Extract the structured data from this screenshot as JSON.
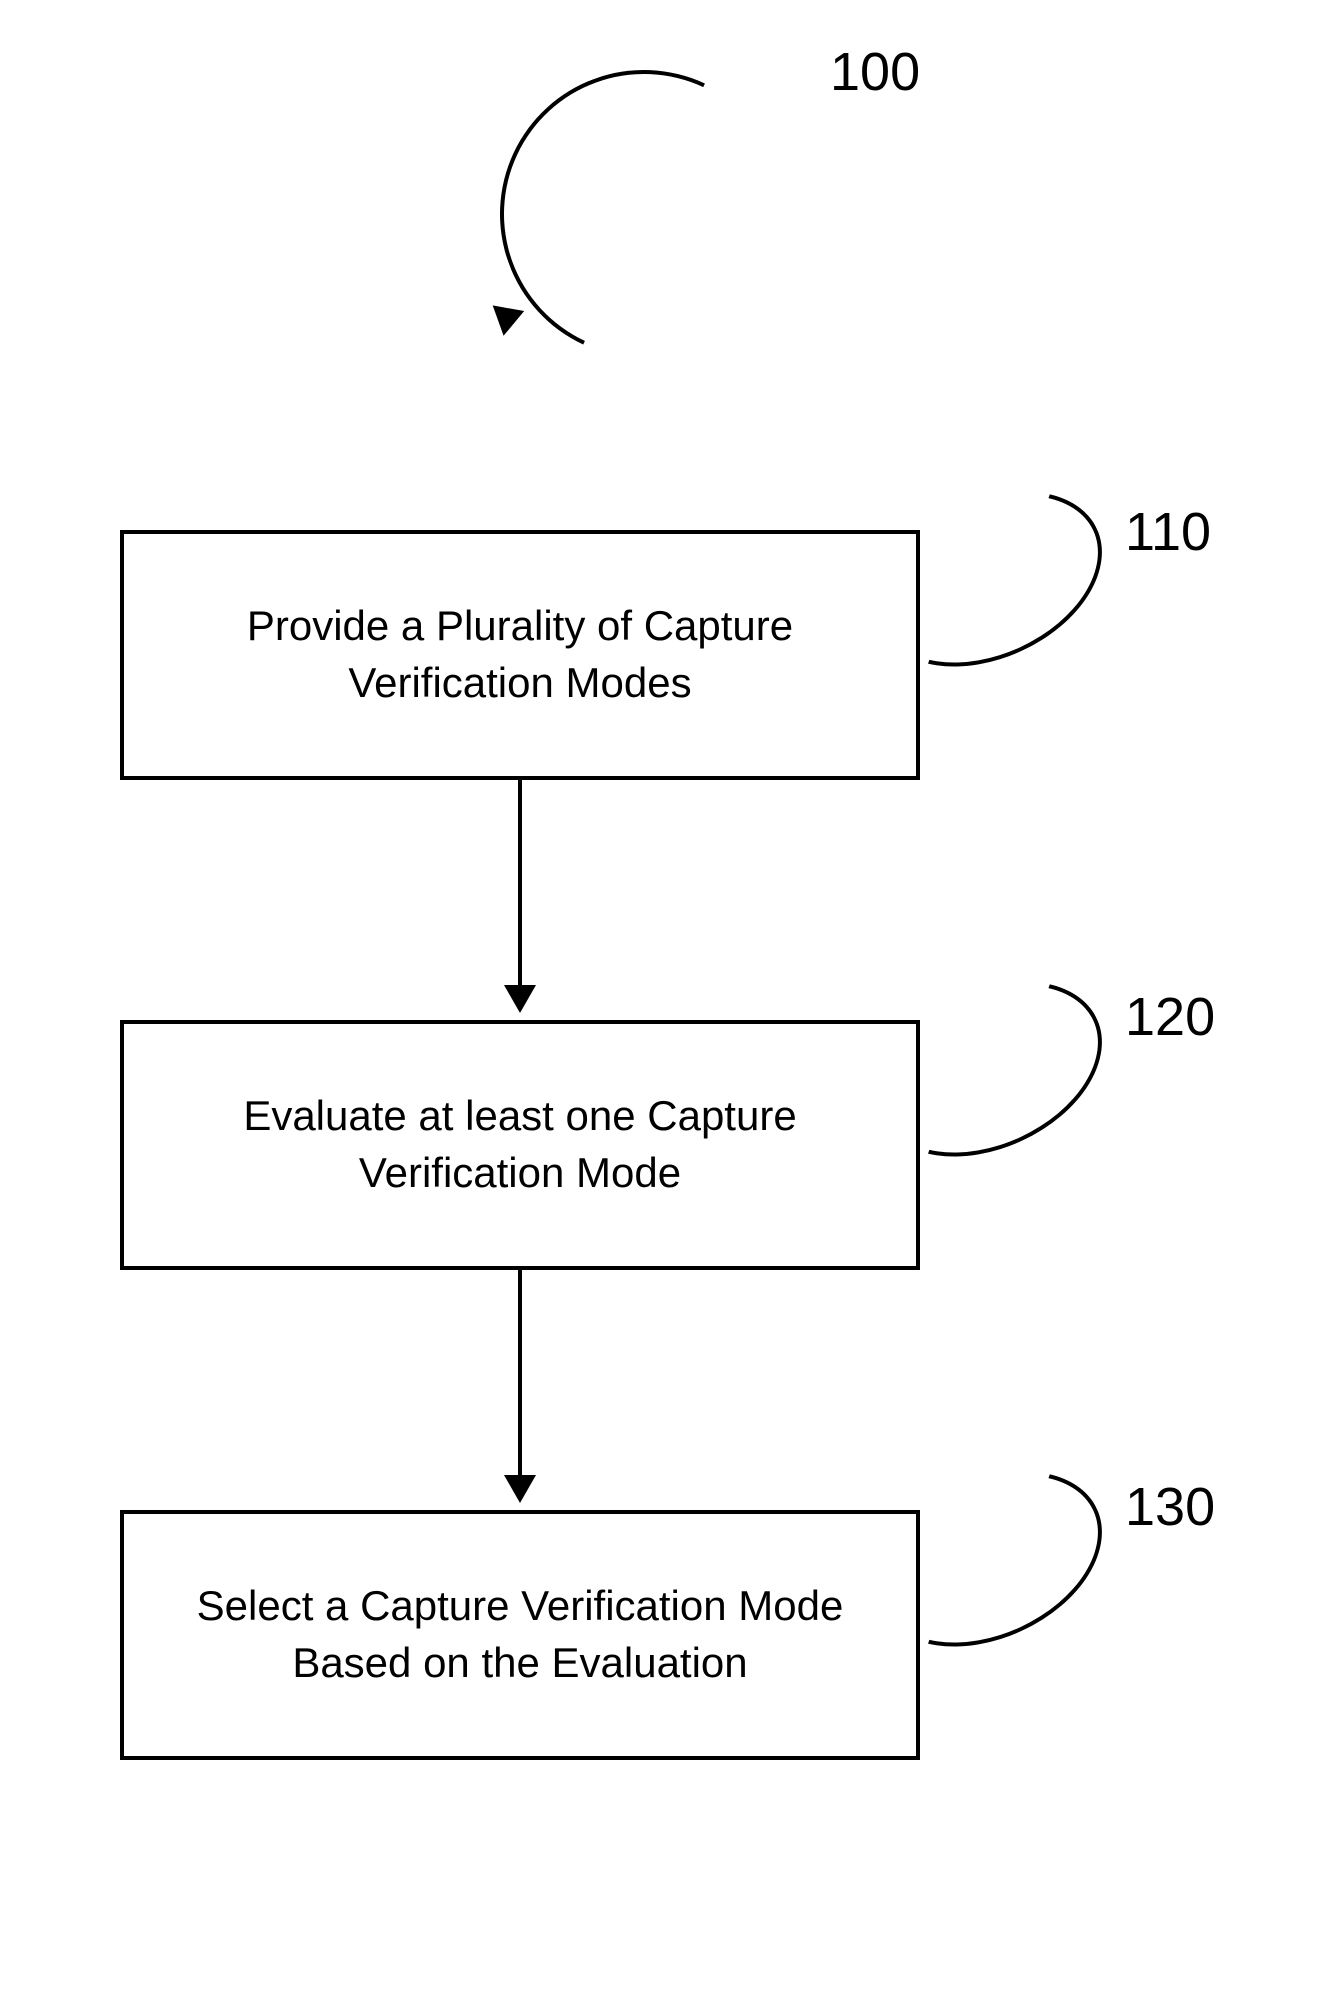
{
  "diagram": {
    "title_label": "100",
    "steps": [
      {
        "ref": "110",
        "text": "Provide a Plurality of Capture\nVerification Modes"
      },
      {
        "ref": "120",
        "text": "Evaluate at least one Capture\nVerification Mode"
      },
      {
        "ref": "130",
        "text": "Select a Capture Verification Mode\nBased on the Evaluation"
      }
    ]
  }
}
